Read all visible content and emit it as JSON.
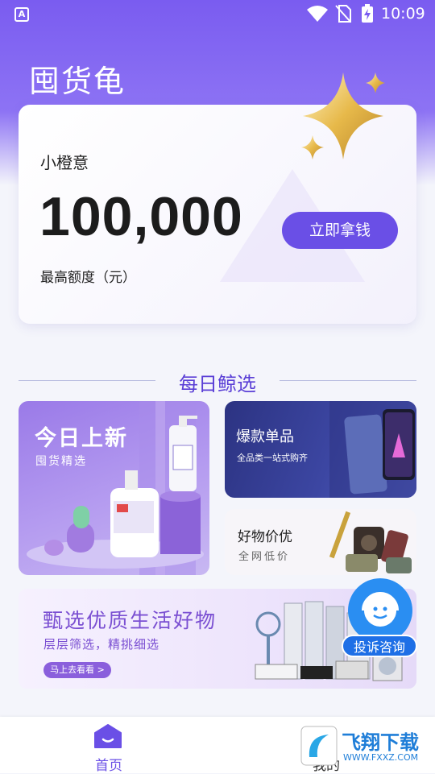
{
  "status_bar": {
    "app_indicator": "A",
    "time": "10:09",
    "icons": [
      "wifi-icon",
      "no-sim-icon",
      "battery-charging-icon"
    ]
  },
  "app": {
    "title": "囤货龟"
  },
  "credit_card": {
    "product_name": "小橙意",
    "amount": "100,000",
    "amount_label": "最高额度（元）",
    "button_label": "立即拿钱"
  },
  "section": {
    "title": "每日鲸选"
  },
  "tiles": {
    "new": {
      "heading": "今日上新",
      "sub": "囤货精选"
    },
    "hot": {
      "heading": "爆款单品",
      "sub": "全品类一站式购齐"
    },
    "deal": {
      "heading": "好物价优",
      "sub": "全网低价"
    }
  },
  "banner": {
    "heading": "甄选优质生活好物",
    "sub": "层层筛选，精挑细选",
    "button_label": "马上去看看 >"
  },
  "support": {
    "label": "投诉咨询"
  },
  "tabbar": {
    "home_label": "首页",
    "mine_label": "我的"
  },
  "watermark": {
    "brand": "飞翔下载",
    "url": "WWW.FXXZ.COM"
  },
  "colors": {
    "accent": "#6a4fe6",
    "hero": "#7a5cf0",
    "support": "#2a8ef2"
  }
}
